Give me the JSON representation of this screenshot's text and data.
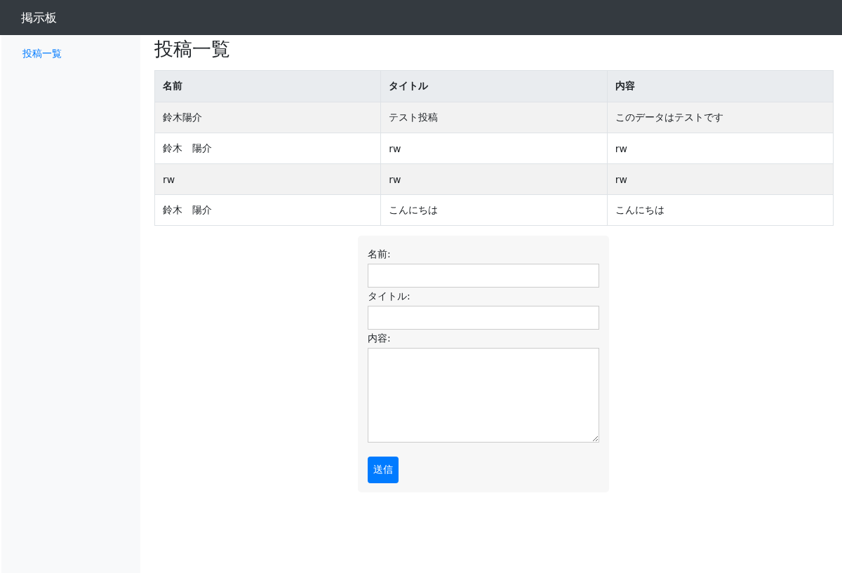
{
  "navbar": {
    "brand": "掲示板"
  },
  "sidebar": {
    "items": [
      {
        "label": "投稿一覧"
      }
    ]
  },
  "page": {
    "heading": "投稿一覧"
  },
  "table": {
    "columns": [
      "名前",
      "タイトル",
      "内容"
    ],
    "rows": [
      [
        "鈴木陽介",
        "テスト投稿",
        "このデータはテストです"
      ],
      [
        "鈴木　陽介",
        "rw",
        "rw"
      ],
      [
        "rw",
        "rw",
        "rw"
      ],
      [
        "鈴木　陽介",
        "こんにちは",
        "こんにちは"
      ]
    ]
  },
  "form": {
    "fields": [
      {
        "label": "名前:",
        "kind": "input"
      },
      {
        "label": "タイトル:",
        "kind": "input"
      },
      {
        "label": "内容:",
        "kind": "textarea"
      }
    ],
    "submit": "送信"
  }
}
